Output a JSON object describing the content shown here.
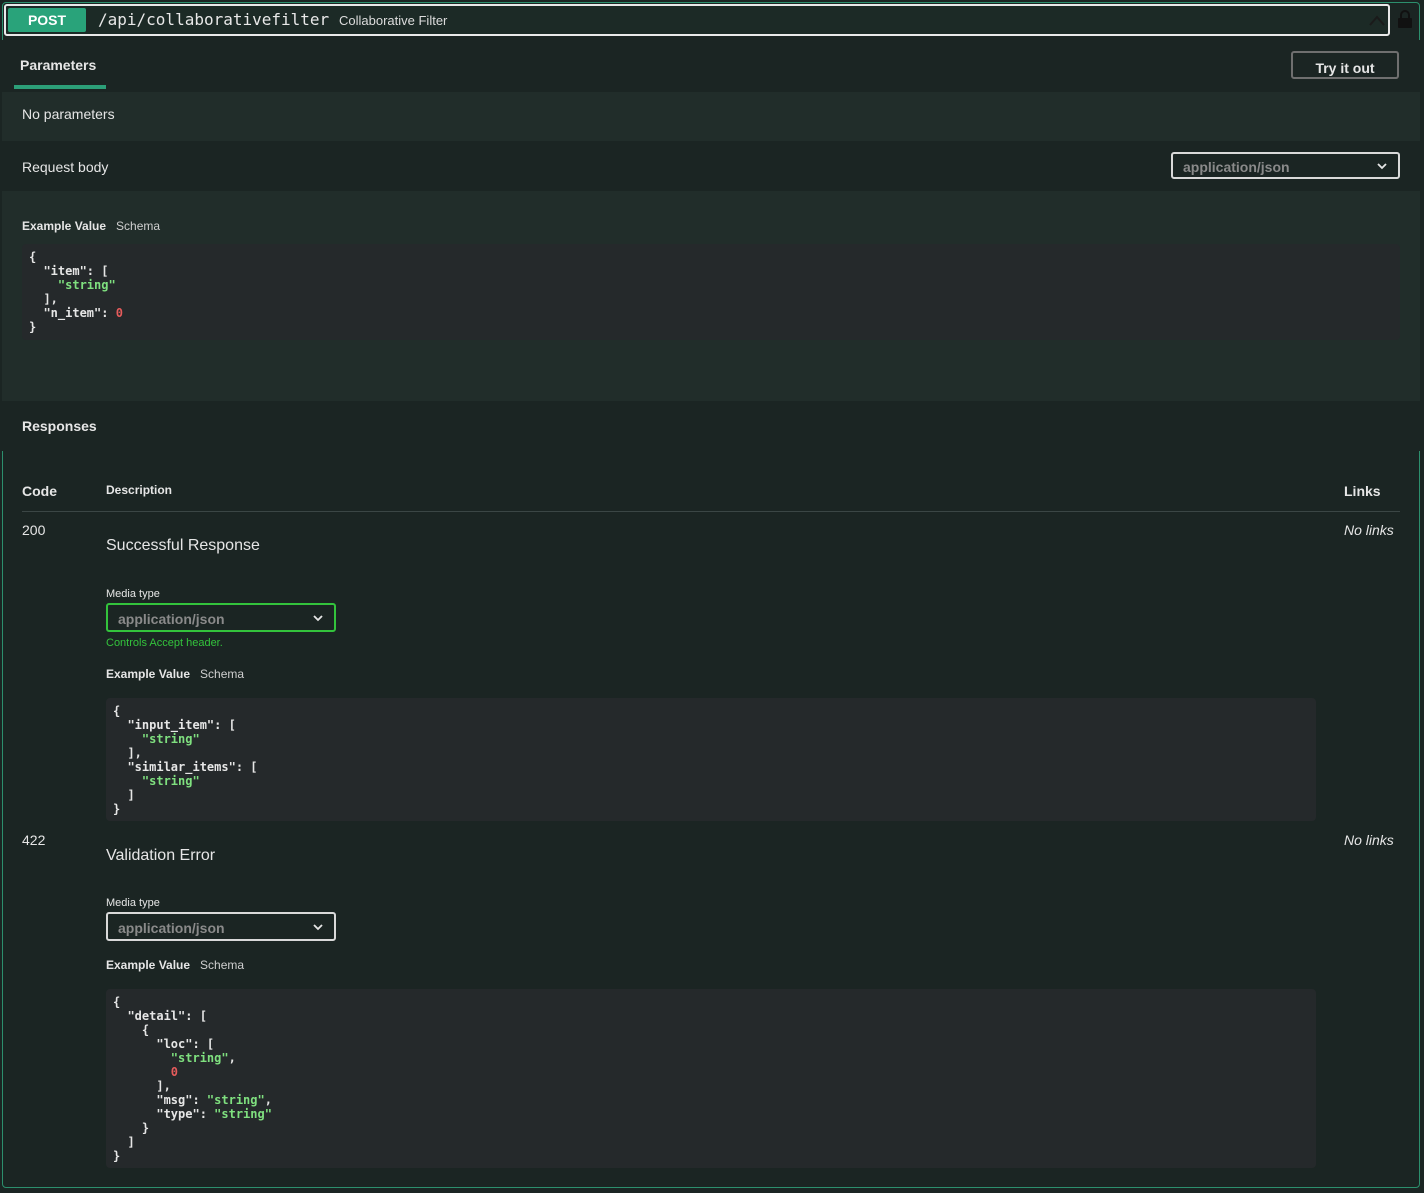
{
  "summary": {
    "method": "POST",
    "path": "/api/collaborativefilter",
    "description": "Collaborative Filter"
  },
  "tabs": {
    "parameters": "Parameters",
    "try_button": "Try it out"
  },
  "no_parameters": "No parameters",
  "request_body": {
    "label": "Request body",
    "content_type": "application/json",
    "example_tab": "Example Value",
    "schema_tab": "Schema"
  },
  "responses": {
    "title": "Responses",
    "columns": {
      "code": "Code",
      "description": "Description",
      "links": "Links"
    },
    "items": [
      {
        "code": "200",
        "description": "Successful Response",
        "links": "No links",
        "media_label": "Media type",
        "media_type": "application/json",
        "controls_note": "Controls Accept header.",
        "example_tab": "Example Value",
        "schema_tab": "Schema"
      },
      {
        "code": "422",
        "description": "Validation Error",
        "links": "No links",
        "media_label": "Media type",
        "media_type": "application/json",
        "example_tab": "Example Value",
        "schema_tab": "Schema"
      }
    ]
  },
  "colors": {
    "accent": "#29a37a",
    "string": "#7fe07f",
    "number": "#e55b5b"
  }
}
